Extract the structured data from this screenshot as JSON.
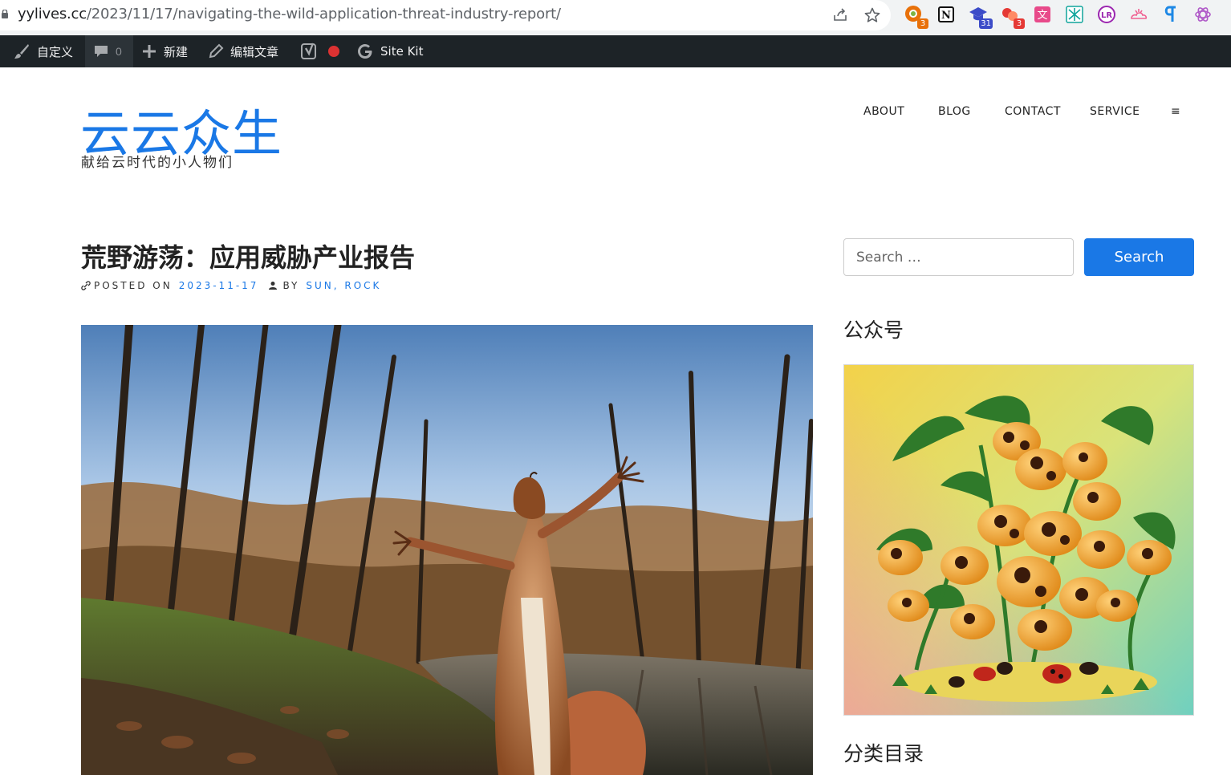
{
  "browser": {
    "url_domain": "yylives.cc",
    "url_path": "/2023/11/17/navigating-the-wild-application-threat-industry-report/",
    "extensions": [
      {
        "name": "ext-grammar-icon",
        "badge": "3",
        "badge_color": "#e8710a"
      },
      {
        "name": "notion-icon",
        "badge": ""
      },
      {
        "name": "graduation-cap-icon",
        "badge": "31",
        "badge_color": "#3c4cc8"
      },
      {
        "name": "ext-circles-icon",
        "badge": "3",
        "badge_color": "#e53935"
      },
      {
        "name": "translate-icon",
        "badge": ""
      },
      {
        "name": "ext-grid-icon",
        "badge": ""
      },
      {
        "name": "ext-lr-icon",
        "badge": ""
      },
      {
        "name": "ext-cloud-icon",
        "badge": ""
      },
      {
        "name": "ext-pilcrow-icon",
        "badge": ""
      },
      {
        "name": "openai-icon",
        "badge": ""
      }
    ]
  },
  "adminbar": {
    "customize": "自定义",
    "comments_count": "0",
    "new": "新建",
    "edit_post": "编辑文章",
    "site_kit": "Site Kit"
  },
  "site": {
    "title": "云云众生",
    "description": "献给云时代的小人物们"
  },
  "nav": {
    "items": [
      "ABOUT",
      "BLOG",
      "CONTACT",
      "SERVICE"
    ],
    "menu_glyph": "≡"
  },
  "post": {
    "title": "荒野游荡：应用威胁产业报告",
    "posted_on_label": "POSTED ON",
    "date": "2023-11-17",
    "by_label": "BY",
    "author": "SUN, ROCK"
  },
  "sidebar": {
    "search_placeholder": "Search …",
    "search_button": "Search",
    "widget1_title": "公众号",
    "widget2_title": "分类目录"
  },
  "colors": {
    "accent": "#1a78e6",
    "adminbar_bg": "#1d2327"
  }
}
